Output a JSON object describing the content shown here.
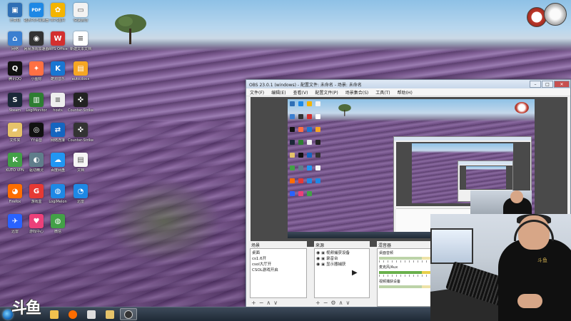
{
  "desktop": {
    "icons": [
      {
        "label": "计算机",
        "color": "#2f6fb5",
        "glyph": "▣"
      },
      {
        "label": "福昕PDF阅读器",
        "color": "#1e88e5",
        "glyph": "PDF"
      },
      {
        "label": "WPS图片",
        "color": "#f4b400",
        "glyph": "✿"
      },
      {
        "label": "快速启动",
        "color": "#f2f2f2",
        "glyph": "▭"
      },
      {
        "label": "网络",
        "color": "#3b7fd0",
        "glyph": "⌂"
      },
      {
        "label": "网易游戏加速器",
        "color": "#333333",
        "glyph": "◉"
      },
      {
        "label": "WPS Office",
        "color": "#d32f2f",
        "glyph": "W"
      },
      {
        "label": "新建文本文档",
        "color": "#ffffff",
        "glyph": "≡"
      },
      {
        "label": "腾讯QQ",
        "color": "#111111",
        "glyph": "Q"
      },
      {
        "label": "小图标",
        "color": "#ff7043",
        "glyph": "✦"
      },
      {
        "label": "酷狗音乐",
        "color": "#1976d2",
        "glyph": "K"
      },
      {
        "label": "auto.docx",
        "color": "#f6a623",
        "glyph": "▤"
      },
      {
        "label": "Steam",
        "color": "#1b2838",
        "glyph": "S"
      },
      {
        "label": "LogiMonitor",
        "color": "#2e7d32",
        "glyph": "▥"
      },
      {
        "label": "hosts",
        "color": "#eeeeee",
        "glyph": "≡"
      },
      {
        "label": "Counter-Strike",
        "color": "#222222",
        "glyph": "✜"
      },
      {
        "label": "文件夹",
        "color": "#e6c36a",
        "glyph": "▰"
      },
      {
        "label": "YY语音",
        "color": "#111111",
        "glyph": "◎"
      },
      {
        "label": "网络连接",
        "color": "#1565c0",
        "glyph": "⇄"
      },
      {
        "label": "Counter-Strike",
        "color": "#333333",
        "glyph": "✜"
      },
      {
        "label": "KUTO VPN",
        "color": "#43a047",
        "glyph": "K"
      },
      {
        "label": "驱动精灵",
        "color": "#607d8b",
        "glyph": "◐"
      },
      {
        "label": "百度网盘",
        "color": "#2196f3",
        "glyph": "☁"
      },
      {
        "label": "文档",
        "color": "#f5f5f5",
        "glyph": "▤"
      },
      {
        "label": "Firefox",
        "color": "#ff6d00",
        "glyph": "◕"
      },
      {
        "label": "游戏盒",
        "color": "#e53935",
        "glyph": "G"
      },
      {
        "label": "LogiMelon",
        "color": "#1e88e5",
        "glyph": "◍"
      },
      {
        "label": "迅雷",
        "color": "#1e88e5",
        "glyph": "◔"
      },
      {
        "label": "迅雷",
        "color": "#2962ff",
        "glyph": "✈"
      },
      {
        "label": "游戏中心",
        "color": "#ec407a",
        "glyph": "♥"
      },
      {
        "label": "微信",
        "color": "#43a047",
        "glyph": "◍"
      }
    ]
  },
  "widgets": {
    "clock_color": "#c0392b",
    "gadget_color": "#e0e0e0"
  },
  "obs": {
    "title": "OBS 23.0.1 (windows) - 配置文件: 未命名 - 场景: 未命名",
    "menu": [
      "文件(F)",
      "编辑(E)",
      "查看(V)",
      "配置文件(P)",
      "场景集合(S)",
      "工具(T)",
      "帮助(H)"
    ],
    "win_buttons": {
      "min": "–",
      "max": "□",
      "close": "✕"
    },
    "scenes": {
      "header": "场景",
      "items": [
        "桌面",
        "cs1.6开",
        "csol大厅开",
        "CSOL游戏开启"
      ]
    },
    "sources": {
      "header": "来源",
      "items": [
        "视频捕获设备",
        "录音台",
        "显示器捕获"
      ]
    },
    "mixer": {
      "header": "混音器",
      "tracks": [
        "桌面音频",
        "麦克风/Aux",
        "视频捕获设备"
      ]
    },
    "footer_controls": {
      "add": "+",
      "remove": "−",
      "up": "∧",
      "down": "∨",
      "settings": "⚙"
    }
  },
  "watermark": "斗鱼",
  "webcam": {
    "shirt_text": "斗鱼"
  },
  "taskbar": {
    "apps": [
      {
        "name": "explorer",
        "color": "#f2c14e"
      },
      {
        "name": "firefox",
        "color": "#ff6d00"
      },
      {
        "name": "counter-strike",
        "color": "#dddddd"
      },
      {
        "name": "folder",
        "color": "#e6c36a"
      },
      {
        "name": "obs",
        "color": "#333333",
        "active": true
      }
    ]
  }
}
